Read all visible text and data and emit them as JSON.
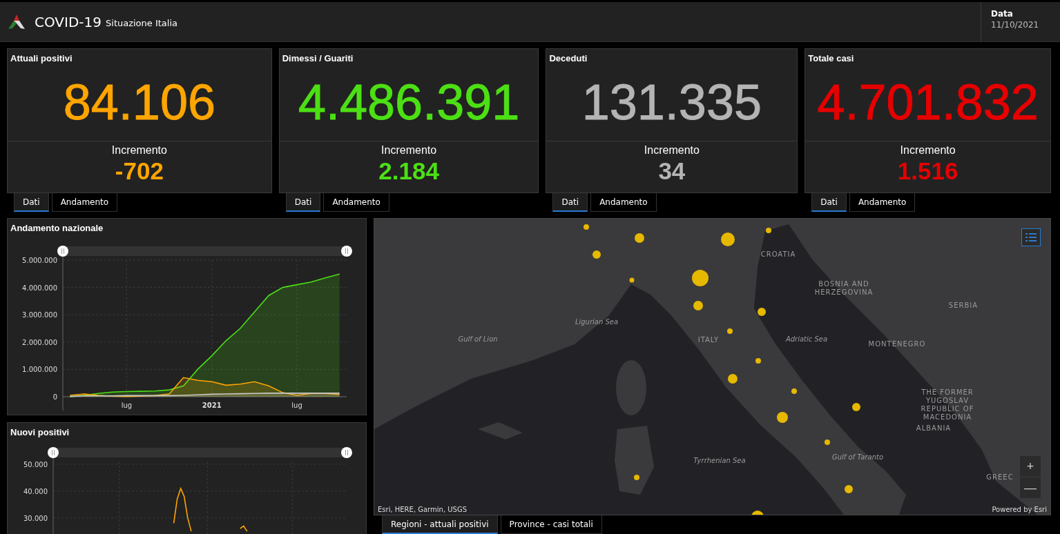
{
  "header": {
    "title": "COVID-19",
    "subtitle": "Situazione Italia",
    "date_label": "Data",
    "date": "11/10/2021"
  },
  "cards": [
    {
      "title": "Attuali positivi",
      "value": "84.106",
      "increment_label": "Incremento",
      "increment": "-702",
      "color": "#ffa500",
      "tabs": [
        {
          "label": "Dati",
          "selected": true
        },
        {
          "label": "Andamento",
          "selected": false
        }
      ]
    },
    {
      "title": "Dimessi / Guariti",
      "value": "4.486.391",
      "increment_label": "Incremento",
      "increment": "2.184",
      "color": "#4ce014",
      "tabs": [
        {
          "label": "Dati",
          "selected": true
        },
        {
          "label": "Andamento",
          "selected": false
        }
      ]
    },
    {
      "title": "Deceduti",
      "value": "131.335",
      "increment_label": "Incremento",
      "increment": "34",
      "color": "#b4b4b4",
      "tabs": [
        {
          "label": "Dati",
          "selected": true
        },
        {
          "label": "Andamento",
          "selected": false
        }
      ]
    },
    {
      "title": "Totale casi",
      "value": "4.701.832",
      "increment_label": "Incremento",
      "increment": "1.516",
      "color": "#e60000",
      "tabs": [
        {
          "label": "Dati",
          "selected": true
        },
        {
          "label": "Andamento",
          "selected": false
        }
      ]
    }
  ],
  "charts": [
    {
      "title": "Andamento nazionale",
      "chart_data": {
        "type": "area",
        "grid": true,
        "categories": [
          null,
          null,
          null,
          null,
          "lug",
          null,
          null,
          null,
          null,
          null,
          "2021",
          null,
          null,
          null,
          null,
          null,
          "lug",
          null,
          null,
          null
        ],
        "ylim": [
          0,
          5000000
        ],
        "yticks": [
          {
            "value": 0,
            "label": "0"
          },
          {
            "value": 1000000,
            "label": "1.000.000"
          },
          {
            "value": 2000000,
            "label": "2.000.000"
          },
          {
            "value": 3000000,
            "label": "3.000.000"
          },
          {
            "value": 4000000,
            "label": "4.000.000"
          },
          {
            "value": 5000000,
            "label": "5.000.000"
          }
        ],
        "series": [
          {
            "color": "#4ce014",
            "values": [
              0,
              50000,
              120000,
              170000,
              190000,
              200000,
              210000,
              250000,
              400000,
              1000000,
              1500000,
              2050000,
              2500000,
              3100000,
              3700000,
              4000000,
              4100000,
              4200000,
              4350000,
              4490000
            ]
          },
          {
            "color": "#ffa500",
            "values": [
              50000,
              100000,
              50000,
              20000,
              10000,
              20000,
              40000,
              100000,
              700000,
              600000,
              550000,
              420000,
              460000,
              550000,
              400000,
              150000,
              50000,
              120000,
              120000,
              80000
            ]
          },
          {
            "color": "#c8c8c8",
            "values": [
              10000,
              30000,
              30000,
              30000,
              40000,
              40000,
              40000,
              40000,
              50000,
              70000,
              90000,
              100000,
              110000,
              120000,
              130000,
              130000,
              130000,
              130000,
              130000,
              130000
            ]
          }
        ]
      }
    },
    {
      "title": "Nuovi positivi",
      "chart_data": {
        "type": "line",
        "grid": true,
        "categories": [
          null,
          null,
          null,
          null,
          null,
          null,
          null,
          null,
          null,
          null,
          null,
          null,
          null,
          null,
          null,
          null,
          null,
          null,
          null,
          null,
          null,
          null,
          null,
          null,
          null,
          null,
          null,
          null,
          null,
          null,
          null,
          null,
          null,
          null,
          null,
          null,
          null,
          null,
          null,
          null,
          null,
          null,
          null,
          null,
          null,
          null,
          null,
          null,
          null,
          null,
          null,
          null,
          null,
          null,
          null,
          null,
          null,
          null,
          null,
          null,
          null,
          null,
          null,
          null,
          null,
          null,
          null,
          null,
          null,
          null,
          null,
          null,
          null,
          null,
          null,
          null,
          null,
          null,
          null,
          null,
          null,
          null,
          null,
          null
        ],
        "ylim": [
          24000,
          51000
        ],
        "yticks": [
          {
            "value": 30000,
            "label": "30.000"
          },
          {
            "value": 40000,
            "label": "40.000"
          },
          {
            "value": 50000,
            "label": "50.000"
          }
        ],
        "series": [
          {
            "color": "#ffa500",
            "values": [
              null,
              null,
              null,
              null,
              null,
              null,
              null,
              null,
              null,
              null,
              null,
              null,
              null,
              null,
              null,
              null,
              null,
              null,
              null,
              null,
              null,
              null,
              null,
              null,
              null,
              null,
              null,
              null,
              null,
              null,
              null,
              null,
              null,
              null,
              28000,
              37000,
              41000,
              38000,
              30000,
              25000,
              null,
              null,
              null,
              null,
              null,
              null,
              null,
              null,
              null,
              null,
              null,
              null,
              null,
              26000,
              27000,
              25000,
              null,
              null,
              null,
              null,
              null,
              null,
              null,
              null,
              null,
              null,
              null,
              null,
              null,
              null,
              null,
              null,
              null,
              null,
              null,
              null,
              null,
              null,
              null,
              null,
              null,
              null,
              null,
              null
            ]
          }
        ]
      }
    }
  ],
  "map": {
    "labels": [
      "CROATIA",
      "BOSNIA AND HERZEGOVINA",
      "SERBIA",
      "Ligurian Sea",
      "Gulf of Lion",
      "ITALY",
      "Adriatic Sea",
      "MONTENEGRO",
      "THE FORMER YUGOSLAV REPUBLIC OF MACEDONIA",
      "ALBANIA",
      "Gulf of Taranto",
      "Tyrrhenian Sea",
      "GREEC"
    ],
    "attribution": "Esri, HERE, Garmin, USGS",
    "powered": "Powered by Esri",
    "zoom_in": "+",
    "zoom_out": "—",
    "tabs": [
      {
        "label": "Regioni - attuali positivi",
        "selected": true
      },
      {
        "label": "Province - casi totali",
        "selected": false
      }
    ]
  }
}
